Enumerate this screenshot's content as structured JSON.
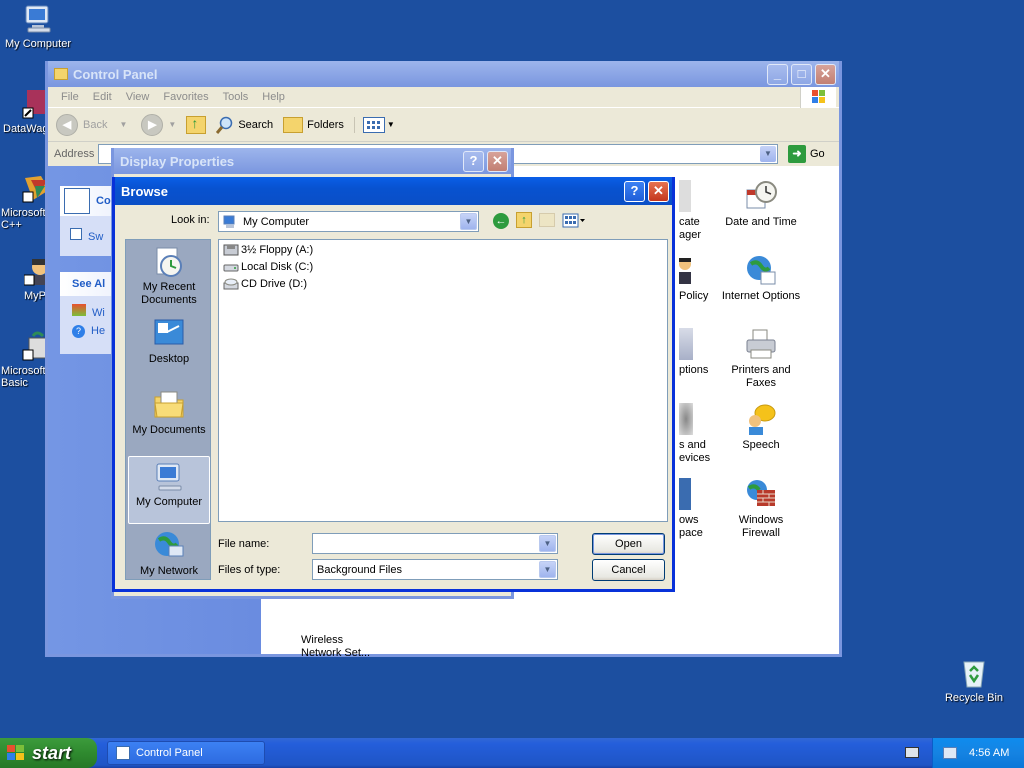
{
  "desktop": {
    "icons": [
      {
        "label": "My Computer"
      },
      {
        "label": "DataWag"
      },
      {
        "label": "Microsoft C++"
      },
      {
        "label": "MyP"
      },
      {
        "label": "Microsoft Basic"
      },
      {
        "label": "Recycle Bin"
      }
    ]
  },
  "control_panel": {
    "title": "Control Panel",
    "menu": [
      "File",
      "Edit",
      "View",
      "Favorites",
      "Tools",
      "Help"
    ],
    "toolbar": {
      "back": "Back",
      "search": "Search",
      "folders": "Folders"
    },
    "address_label": "Address",
    "go_label": "Go",
    "left_partial": {
      "task_label": "Co",
      "switch_label": "Sw",
      "see_also": "See Al",
      "wi": "Wi",
      "he": "He"
    },
    "items": [
      {
        "label": "cate\nager"
      },
      {
        "label": "Date and Time"
      },
      {
        "label": "Policy"
      },
      {
        "label": "Internet Options"
      },
      {
        "label": "ptions"
      },
      {
        "label": "Printers and Faxes"
      },
      {
        "label": "s and\nevices"
      },
      {
        "label": "Speech"
      },
      {
        "label": "ows\npace"
      },
      {
        "label": "Windows Firewall"
      },
      {
        "label": "Wireless\nNetwork Set..."
      }
    ]
  },
  "display_properties": {
    "title": "Display Properties"
  },
  "browse": {
    "title": "Browse",
    "look_in_label": "Look in:",
    "look_in_value": "My Computer",
    "places": [
      "My Recent Documents",
      "Desktop",
      "My Documents",
      "My Computer",
      "My Network"
    ],
    "files": [
      "3½ Floppy (A:)",
      "Local Disk (C:)",
      "CD Drive (D:)"
    ],
    "file_name_label": "File name:",
    "file_name_value": "",
    "files_of_type_label": "Files of type:",
    "files_of_type_value": "Background Files",
    "open_label": "Open",
    "cancel_label": "Cancel"
  },
  "taskbar": {
    "start_label": "start",
    "task_label": "Control Panel",
    "clock": "4:56 AM"
  }
}
